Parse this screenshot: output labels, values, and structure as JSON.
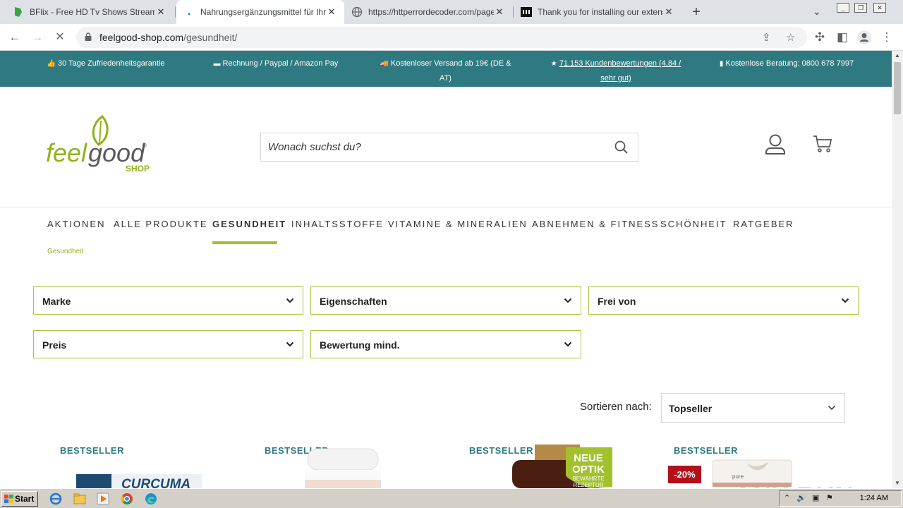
{
  "browser": {
    "tabs": [
      {
        "title": "BFlix - Free HD Tv Shows Streaming - BFli",
        "active": false
      },
      {
        "title": "Nahrungsergänzungsmittel für Ihre Gesundh",
        "active": true
      },
      {
        "title": "https://httperrordecoder.com/page/",
        "active": false
      },
      {
        "title": "Thank you for installing our extension!",
        "active": false
      }
    ],
    "url_domain": "feelgood-shop.com",
    "url_path": "/gesundheit/"
  },
  "topbar": {
    "items": [
      {
        "icon": "thumbs-up-icon",
        "text": "30 Tage Zufriedenheitsgarantie"
      },
      {
        "icon": "credit-card-icon",
        "text": "Rechnung / Paypal / Amazon Pay"
      },
      {
        "icon": "truck-icon",
        "text": "Kostenloser Versand ab 19€ (DE & AT)"
      },
      {
        "icon": "star-icon",
        "text": "71.153 Kundenbewertungen (4,84 / sehr gut)"
      },
      {
        "icon": "chat-icon",
        "text": "Kostenlose Beratung: 0800 678 7997"
      }
    ]
  },
  "header": {
    "logo_text": "feelgood",
    "logo_sub": "SHOP",
    "search_placeholder": "Wonach suchst du?"
  },
  "nav": {
    "items": [
      "AKTIONEN",
      "ALLE PRODUKTE",
      "GESUNDHEIT",
      "INHALTSSTOFFE",
      "VITAMINE & MINERALIEN",
      "ABNEHMEN & FITNESS",
      "SCHÖNHEIT",
      "RATGEBER"
    ],
    "active": "GESUNDHEIT"
  },
  "breadcrumb": "Gesundheit",
  "filters": {
    "marke": "Marke",
    "eigenschaften": "Eigenschaften",
    "frei_von": "Frei von",
    "preis": "Preis",
    "bewertung": "Bewertung mind."
  },
  "sort": {
    "label": "Sortieren nach:",
    "value": "Topseller"
  },
  "products": {
    "badge": "BESTSELLER",
    "discount": "-20%",
    "p1_text": "CURCUMA",
    "p3_label": [
      "NEUE",
      "OPTIK",
      "BEWÄHRTE",
      "REZEPTUR"
    ],
    "p4_text": "pure"
  },
  "watermark": "ANY RUN",
  "taskbar": {
    "start": "Start",
    "clock": "1:24 AM"
  },
  "colors": {
    "teal": "#2f7a80",
    "green": "#a3c12d",
    "discount_red": "#b3101b"
  }
}
